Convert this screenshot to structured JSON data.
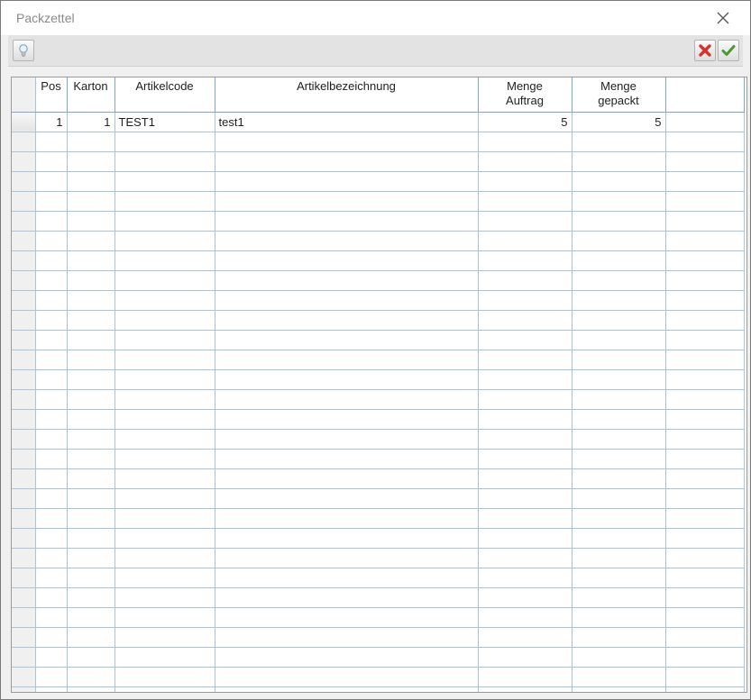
{
  "window": {
    "title": "Packzettel"
  },
  "toolbar": {
    "hint_icon": "lightbulb-icon",
    "cancel_icon": "red-x-icon",
    "confirm_icon": "green-check-icon"
  },
  "colors": {
    "cancel": "#d9322a",
    "confirm": "#4a9a2e",
    "grid_line": "#aac4de"
  },
  "grid": {
    "columns": [
      "Pos",
      "Karton",
      "Artikelcode",
      "Artikelbezeichnung",
      "Menge\nAuftrag",
      "Menge\ngepackt",
      ""
    ],
    "rows": [
      {
        "pos": "1",
        "karton": "1",
        "artikelcode": "TEST1",
        "artikelbezeichnung": "test1",
        "menge_auftrag": "5",
        "menge_gepackt": "5"
      }
    ]
  }
}
